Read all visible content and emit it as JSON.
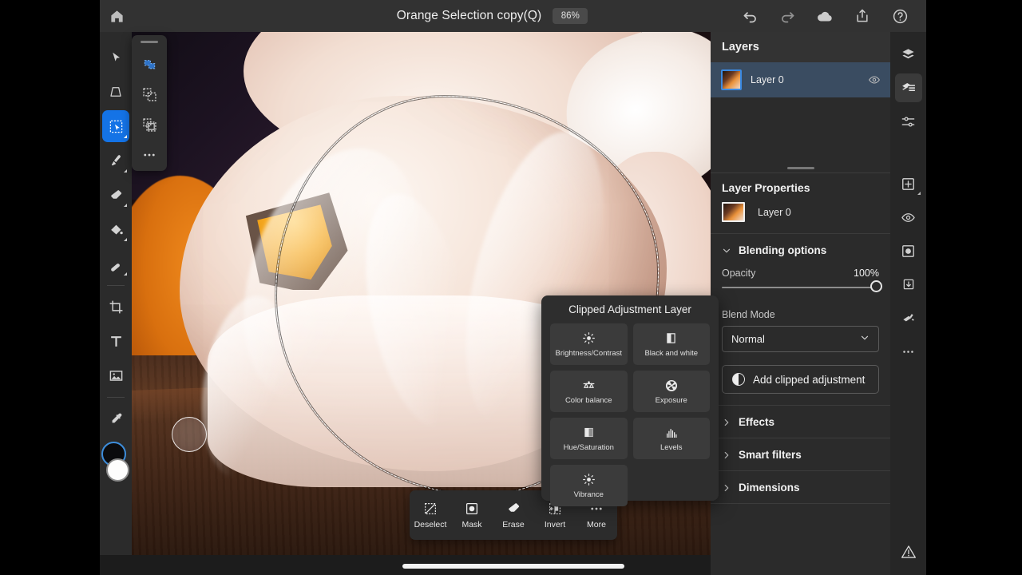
{
  "app": {
    "accent_color": "#1473e6",
    "panel_bg": "#2b2b2b",
    "selection_row_bg": "#3a4c61"
  },
  "topbar": {
    "home_icon": "home-icon",
    "document_title": "Orange Selection copy(Q)",
    "zoom_level": "86%",
    "actions": [
      {
        "icon": "undo-icon",
        "label": "Undo"
      },
      {
        "icon": "redo-icon",
        "label": "Redo"
      },
      {
        "icon": "cloud-icon",
        "label": "Cloud"
      },
      {
        "icon": "share-icon",
        "label": "Share"
      },
      {
        "icon": "help-icon",
        "label": "Help"
      }
    ]
  },
  "toolbar": {
    "tools": [
      {
        "name": "move-tool",
        "icon": "cursor-arrow-icon",
        "active": false,
        "has_submenu": false
      },
      {
        "name": "transform-tool",
        "icon": "transform-icon",
        "active": false,
        "has_submenu": false
      },
      {
        "name": "selection-tool",
        "icon": "quick-select-icon",
        "active": true,
        "has_submenu": true
      },
      {
        "name": "brush-tool",
        "icon": "brush-icon",
        "active": false,
        "has_submenu": true
      },
      {
        "name": "eraser-tool",
        "icon": "eraser-icon",
        "active": false,
        "has_submenu": true
      },
      {
        "name": "fill-tool",
        "icon": "paint-bucket-icon",
        "active": false,
        "has_submenu": true
      },
      {
        "name": "healing-tool",
        "icon": "healing-brush-icon",
        "active": false,
        "has_submenu": true
      },
      {
        "name": "crop-tool",
        "icon": "crop-icon",
        "active": false,
        "has_submenu": false
      },
      {
        "name": "type-tool",
        "icon": "text-t-icon",
        "active": false,
        "has_submenu": false
      },
      {
        "name": "place-image-tool",
        "icon": "image-icon",
        "active": false,
        "has_submenu": false
      },
      {
        "name": "eyedropper-tool",
        "icon": "eyedropper-icon",
        "active": false,
        "has_submenu": false
      }
    ],
    "swatches": {
      "foreground": "#0b0b0d",
      "background": "#fdfdfd"
    }
  },
  "tool_flyout": {
    "items": [
      {
        "name": "new-selection-mode",
        "icon": "new-selection-icon",
        "active": true
      },
      {
        "name": "add-to-selection-mode",
        "icon": "add-selection-icon",
        "active": false
      },
      {
        "name": "subtract-from-selection-mode",
        "icon": "subtract-selection-icon",
        "active": false
      },
      {
        "name": "more-selection-options",
        "icon": "more-dots-icon",
        "active": false
      }
    ]
  },
  "layers_panel": {
    "title": "Layers",
    "layers": [
      {
        "name": "Layer 0",
        "selected": true,
        "visible": true,
        "visibility_icon": "eye-icon"
      }
    ]
  },
  "layer_properties": {
    "title": "Layer Properties",
    "layer_name": "Layer 0",
    "blending": {
      "section_label": "Blending options",
      "expanded": true,
      "opacity_label": "Opacity",
      "opacity_value": "100%",
      "blend_mode_label": "Blend Mode",
      "blend_mode_value": "Normal"
    },
    "add_clipped_adjustment_label": "Add clipped adjustment",
    "sections": [
      {
        "label": "Effects",
        "expanded": false
      },
      {
        "label": "Smart filters",
        "expanded": false
      },
      {
        "label": "Dimensions",
        "expanded": false
      }
    ]
  },
  "icon_rail": {
    "items": [
      {
        "name": "layers-stack-icon",
        "active": false
      },
      {
        "name": "layers-list-icon",
        "active": true
      },
      {
        "name": "adjustments-sliders-icon",
        "active": false
      },
      {
        "name": "add-layer-icon",
        "active": false,
        "has_submenu": true
      },
      {
        "name": "layer-visibility-icon",
        "active": false
      },
      {
        "name": "layer-mask-icon",
        "active": false
      },
      {
        "name": "merge-down-icon",
        "active": false
      },
      {
        "name": "clipping-mask-icon",
        "active": false
      },
      {
        "name": "more-options-icon",
        "active": false
      },
      {
        "name": "warning-triangle-icon",
        "active": false
      }
    ]
  },
  "adjustment_popup": {
    "title": "Clipped Adjustment Layer",
    "items": [
      {
        "label": "Brightness/Contrast",
        "icon": "brightness-icon"
      },
      {
        "label": "Black and white",
        "icon": "black-white-icon"
      },
      {
        "label": "Color balance",
        "icon": "scales-icon"
      },
      {
        "label": "Exposure",
        "icon": "aperture-icon"
      },
      {
        "label": "Hue/Saturation",
        "icon": "hue-saturation-icon"
      },
      {
        "label": "Levels",
        "icon": "levels-histogram-icon"
      },
      {
        "label": "Vibrance",
        "icon": "vibrance-icon"
      }
    ]
  },
  "bottom_toolbar": {
    "items": [
      {
        "label": "Deselect",
        "icon": "deselect-icon"
      },
      {
        "label": "Mask",
        "icon": "mask-icon"
      },
      {
        "label": "Erase",
        "icon": "eraser-icon"
      },
      {
        "label": "Invert",
        "icon": "invert-selection-icon"
      },
      {
        "label": "More",
        "icon": "more-dots-icon"
      }
    ]
  },
  "canvas": {
    "description": "Still-life painting of oranges wrapped in white tissue paper on a wooden table",
    "active_selection": true
  }
}
